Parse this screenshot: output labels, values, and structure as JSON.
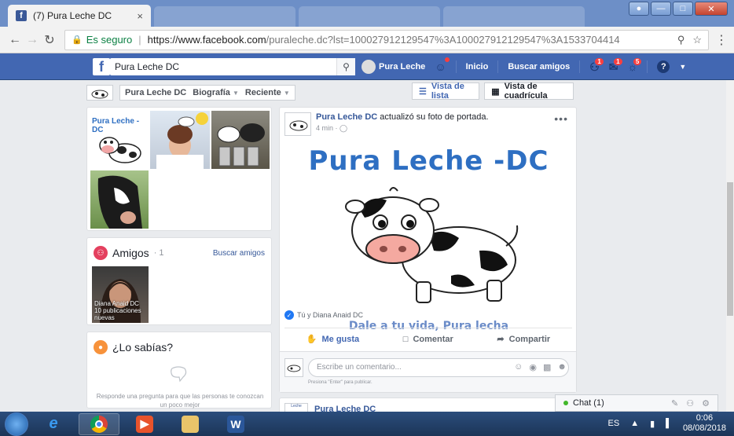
{
  "browser": {
    "tab_title": "(7) Pura Leche DC",
    "tab_close": "×",
    "secure_label": "Es seguro",
    "url_host": "https://www.facebook.com",
    "url_rest": "/puraleche.dc?lst=100027912129547%3A100027912129547%3A1533704414"
  },
  "fb_header": {
    "logo": "f",
    "search_value": "Pura Leche DC",
    "profile_label": "Pura Leche",
    "home_label": "Inicio",
    "find_friends_label": "Buscar amigos",
    "friend_requests_badge": "1",
    "messages_badge": "1",
    "notifications_badge": "5",
    "help": "?"
  },
  "subnav": {
    "page_name": "Pura Leche DC",
    "biography": "Biografía",
    "recent": "Reciente",
    "list_view": "Vista de lista",
    "grid_view": "Vista de cuadrícula"
  },
  "photos_card": {
    "logo_text": "Pura Leche -DC"
  },
  "friends_card": {
    "title": "Amigos",
    "count": "· 1",
    "link": "Buscar amigos",
    "friend_name": "Diana Anaid DC",
    "friend_note": "10 publicaciones nuevas"
  },
  "didyouknow_card": {
    "title": "¿Lo sabías?",
    "text": "Responde una pregunta para que las personas te conozcan un poco mejor"
  },
  "post": {
    "author": "Pura Leche DC",
    "action": " actualizó su foto de portada.",
    "time": "4 min ·",
    "more": "•••",
    "cover_title": "Pura Leche -DC",
    "cover_subtitle": "Dale a tu vida, Pura lecha",
    "reactions": "Tú y Diana Anaid DC",
    "like": "Me gusta",
    "comment": "Comentar",
    "share": "Compartir",
    "comment_placeholder": "Escribe un comentario...",
    "comment_hint": "Presiona \"Enter\" para publicar."
  },
  "post2": {
    "author": "Pura Leche DC"
  },
  "chat": {
    "label": "Chat (1)"
  },
  "taskbar": {
    "lang": "ES",
    "time": "0:06",
    "date": "08/08/2018"
  },
  "colors": {
    "fb_blue": "#4267b2",
    "link": "#365899",
    "cover_blue": "#2e6fc2"
  }
}
